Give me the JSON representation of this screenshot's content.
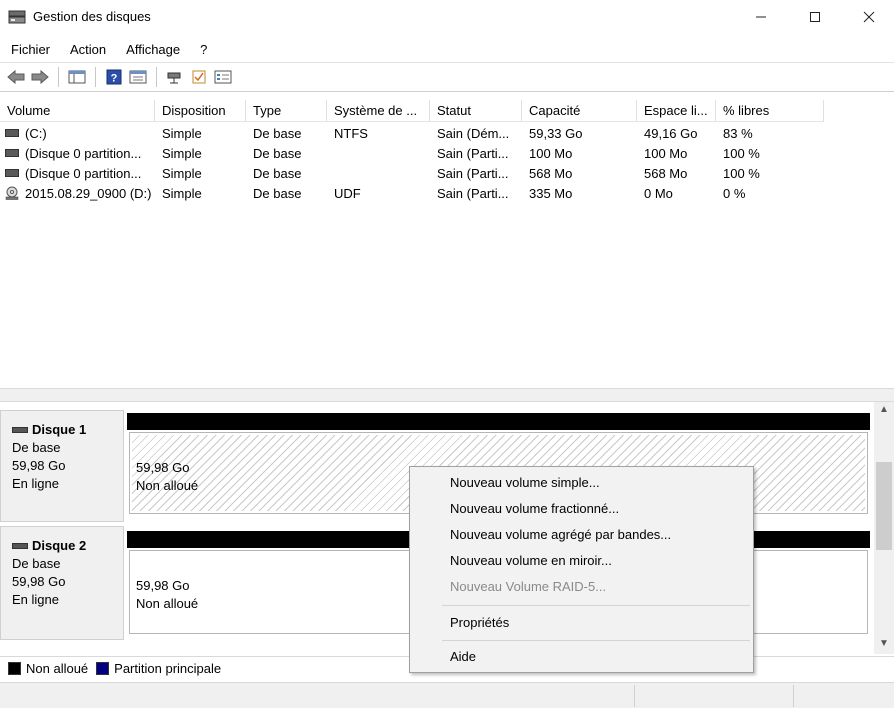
{
  "window": {
    "title": "Gestion des disques",
    "minimize_glyph": "—",
    "maximize_glyph": "☐",
    "close_glyph": "✕"
  },
  "menu": [
    {
      "label": "Fichier"
    },
    {
      "label": "Action"
    },
    {
      "label": "Affichage"
    },
    {
      "label": "?"
    }
  ],
  "toolbar": {
    "buttons": [
      "back-arrow-icon",
      "forward-arrow-icon",
      "console-tree-icon",
      "help-icon",
      "properties-icon",
      "connect-icon",
      "check-icon",
      "settings-list-icon"
    ]
  },
  "volume_table": {
    "columns": [
      "Volume",
      "Disposition",
      "Type",
      "Système de ...",
      "Statut",
      "Capacité",
      "Espace li...",
      "% libres"
    ],
    "rows": [
      {
        "volume": "(C:)",
        "icon": "volume-icon",
        "disposition": "Simple",
        "type": "De base",
        "fs": "NTFS",
        "status": "Sain (Dém...",
        "capacity": "59,33 Go",
        "free": "49,16 Go",
        "pct": "83 %"
      },
      {
        "volume": "(Disque 0 partition...",
        "icon": "volume-icon",
        "disposition": "Simple",
        "type": "De base",
        "fs": "",
        "status": "Sain (Parti...",
        "capacity": "100 Mo",
        "free": "100 Mo",
        "pct": "100 %"
      },
      {
        "volume": "(Disque 0 partition...",
        "icon": "volume-icon",
        "disposition": "Simple",
        "type": "De base",
        "fs": "",
        "status": "Sain (Parti...",
        "capacity": "568 Mo",
        "free": "568 Mo",
        "pct": "100 %"
      },
      {
        "volume": "2015.08.29_0900 (D:)",
        "icon": "cd-drive-icon",
        "disposition": "Simple",
        "type": "De base",
        "fs": "UDF",
        "status": "Sain (Parti...",
        "capacity": "335 Mo",
        "free": "0 Mo",
        "pct": "0 %"
      }
    ]
  },
  "disks": [
    {
      "name": "Disque 1",
      "kind": "De base",
      "size": "59,98 Go",
      "state": "En ligne",
      "partition_size": "59,98 Go",
      "partition_state": "Non alloué"
    },
    {
      "name": "Disque 2",
      "kind": "De base",
      "size": "59,98 Go",
      "state": "En ligne",
      "partition_size": "59,98 Go",
      "partition_state": "Non alloué"
    }
  ],
  "legend": [
    {
      "label": "Non alloué",
      "color": "#000000"
    },
    {
      "label": "Partition principale",
      "color": "#000080"
    }
  ],
  "context_menu": {
    "items": [
      {
        "label": "Nouveau volume simple...",
        "enabled": true
      },
      {
        "label": "Nouveau volume fractionné...",
        "enabled": true
      },
      {
        "label": "Nouveau volume agrégé par bandes...",
        "enabled": true
      },
      {
        "label": "Nouveau volume en miroir...",
        "enabled": true
      },
      {
        "label": "Nouveau Volume RAID-5...",
        "enabled": false
      },
      {
        "label": "Propriétés",
        "enabled": true
      },
      {
        "label": "Aide",
        "enabled": true
      }
    ]
  },
  "scrollbar": {
    "up_glyph": "▲",
    "down_glyph": "▼"
  }
}
